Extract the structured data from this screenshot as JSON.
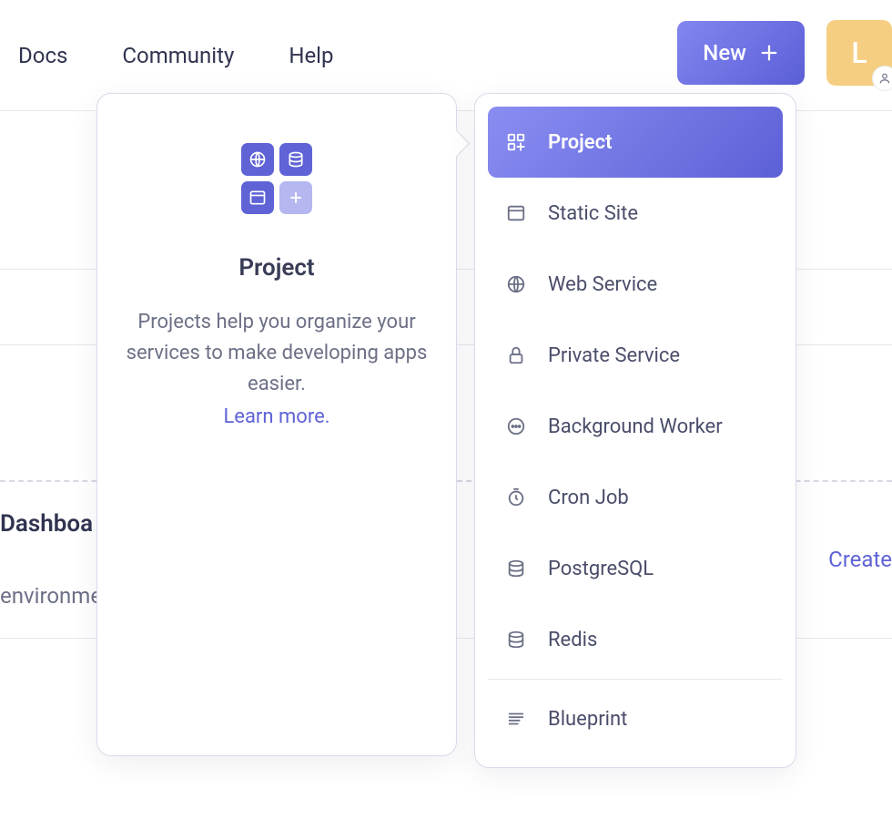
{
  "nav": {
    "links": [
      "Docs",
      "Community",
      "Help"
    ],
    "new_label": "New",
    "avatar_initial": "L"
  },
  "background": {
    "heading": "Dashboa",
    "subtext": "environme",
    "create": "Create"
  },
  "info": {
    "title": "Project",
    "description": "Projects help you organize your services to make developing apps easier.",
    "learn_more": "Learn more."
  },
  "menu": {
    "items": [
      {
        "id": "project",
        "label": "Project",
        "icon": "grid-plus",
        "active": true
      },
      {
        "id": "static-site",
        "label": "Static Site",
        "icon": "window"
      },
      {
        "id": "web-service",
        "label": "Web Service",
        "icon": "globe"
      },
      {
        "id": "private-service",
        "label": "Private Service",
        "icon": "lock"
      },
      {
        "id": "background-worker",
        "label": "Background Worker",
        "icon": "dots"
      },
      {
        "id": "cron-job",
        "label": "Cron Job",
        "icon": "timer"
      },
      {
        "id": "postgresql",
        "label": "PostgreSQL",
        "icon": "database"
      },
      {
        "id": "redis",
        "label": "Redis",
        "icon": "database"
      }
    ],
    "blueprint": {
      "id": "blueprint",
      "label": "Blueprint",
      "icon": "lines"
    }
  }
}
